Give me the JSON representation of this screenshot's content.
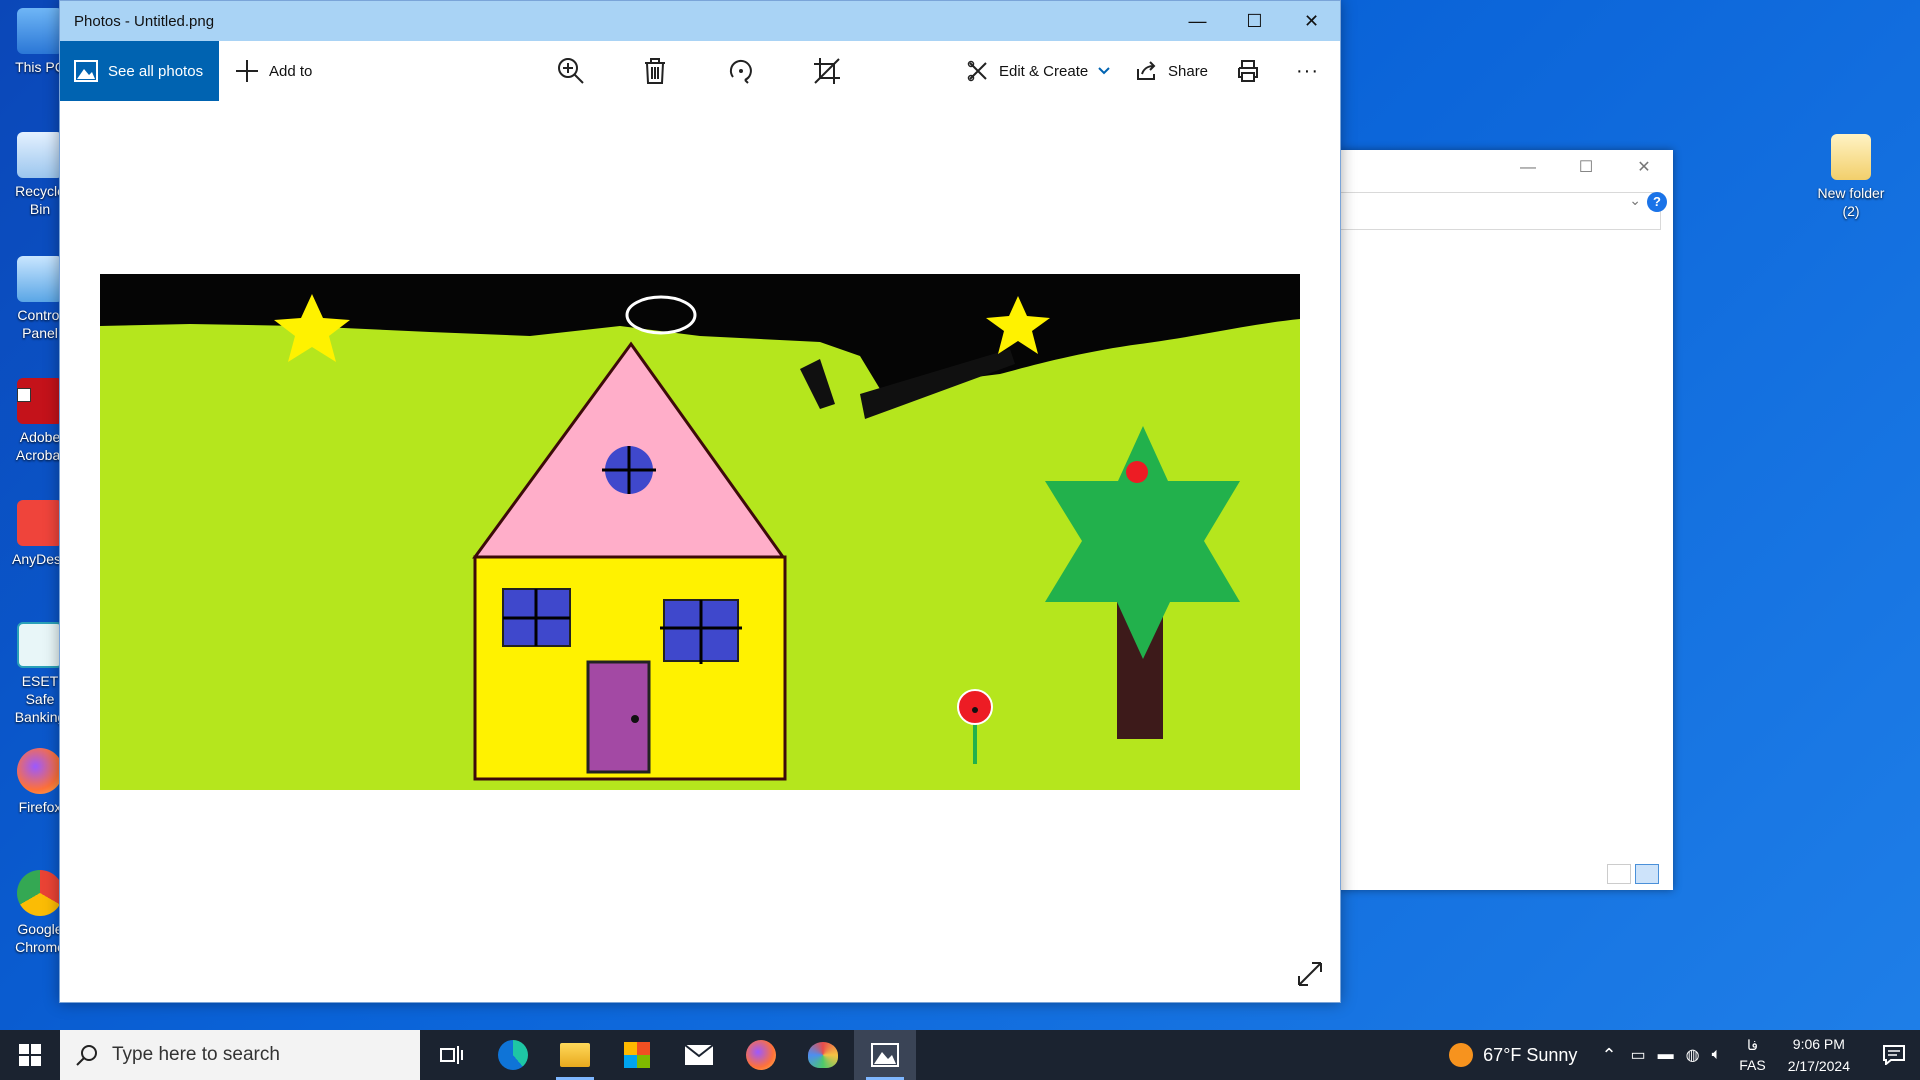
{
  "window": {
    "title": "Photos - Untitled.png",
    "minimize": "—",
    "maximize": "☐",
    "close": "✕"
  },
  "toolbar": {
    "see_all_photos": "See all photos",
    "add_to": "Add to",
    "edit_create": "Edit & Create",
    "share": "Share",
    "more": "···"
  },
  "desktop_icons": [
    {
      "label": "This PC"
    },
    {
      "label": "Recycle Bin"
    },
    {
      "label": "Control Panel"
    },
    {
      "label": "Adobe Acrobat"
    },
    {
      "label": "AnyDesk"
    },
    {
      "label": "ESET Safe Banking"
    },
    {
      "label": "Firefox"
    },
    {
      "label": "Google Chrome"
    }
  ],
  "desktop_right_icon": {
    "label": "New folder (2)"
  },
  "taskbar": {
    "search_placeholder": "Type here to search",
    "weather": "67°F  Sunny",
    "lang_top": "فا",
    "lang_bottom": "FAS",
    "time": "9:06 PM",
    "date": "2/17/2024"
  },
  "colors": {
    "accent": "#0063b1",
    "titlebar": "#a9d3f5",
    "grass": "#b5e61d",
    "sky": "#000000",
    "roof": "#ffaec9",
    "wall": "#fff200",
    "window_glass": "#3f48cc",
    "door": "#a349a4",
    "tree": "#22b14c",
    "trunk": "#3d1a1a",
    "flower": "#ed1c24",
    "star": "#fff200"
  }
}
